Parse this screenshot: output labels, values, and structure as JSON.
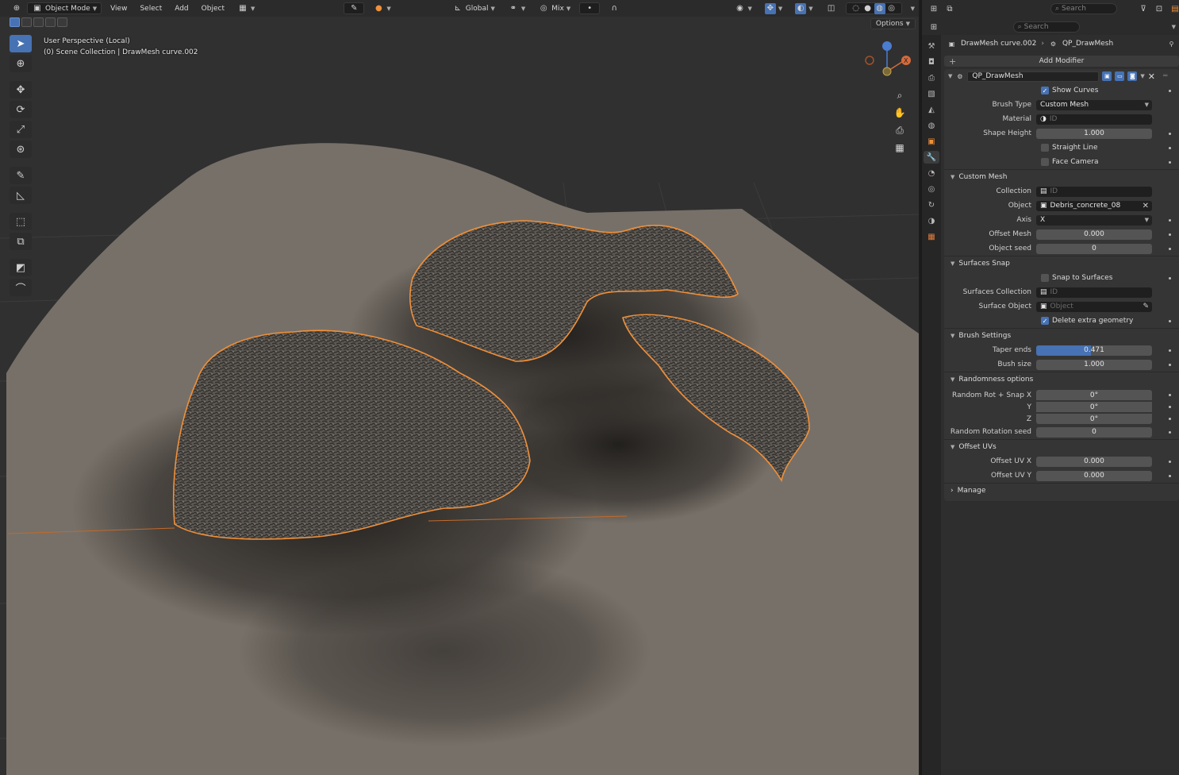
{
  "viewport": {
    "header": {
      "mode": "Object Mode",
      "menus": [
        "View",
        "Select",
        "Add",
        "Object"
      ],
      "orientation": "Global",
      "proportional": "Mix"
    },
    "options_label": "Options",
    "overlay_line1": "User Perspective (Local)",
    "overlay_line2": "(0) Scene Collection | DrawMesh curve.002",
    "gizmo_axis_x": "X"
  },
  "properties": {
    "search_placeholder": "Search",
    "search2_placeholder": "Search",
    "breadcrumb_object": "DrawMesh curve.002",
    "breadcrumb_modifier": "QP_DrawMesh",
    "add_modifier": "Add Modifier",
    "modifier_name": "QP_DrawMesh",
    "show_curves": "Show Curves",
    "brush_type_label": "Brush Type",
    "brush_type_value": "Custom Mesh",
    "material_label": "Material",
    "material_placeholder": "ID",
    "shape_height_label": "Shape Height",
    "shape_height_value": "1.000",
    "straight_line": "Straight Line",
    "face_camera": "Face Camera",
    "custom_mesh": {
      "title": "Custom Mesh",
      "collection_label": "Collection",
      "collection_placeholder": "ID",
      "object_label": "Object",
      "object_value": "Debris_concrete_08",
      "axis_label": "Axis",
      "axis_value": "X",
      "offset_mesh_label": "Offset Mesh",
      "offset_mesh_value": "0.000",
      "object_seed_label": "Object seed",
      "object_seed_value": "0"
    },
    "surfaces_snap": {
      "title": "Surfaces Snap",
      "snap_label": "Snap to Surfaces",
      "surfaces_collection_label": "Surfaces Collection",
      "surfaces_collection_placeholder": "ID",
      "surface_object_label": "Surface Object",
      "surface_object_placeholder": "Object",
      "delete_extra": "Delete extra geometry"
    },
    "brush_settings": {
      "title": "Brush Settings",
      "taper_label": "Taper ends",
      "taper_value": "0.471",
      "taper_fraction": 0.471,
      "bush_size_label": "Bush size",
      "bush_size_value": "1.000"
    },
    "randomness": {
      "title": "Randomness options",
      "rot_x_label": "Random Rot + Snap X",
      "rot_x_value": "0°",
      "rot_y_label": "Y",
      "rot_y_value": "0°",
      "rot_z_label": "Z",
      "rot_z_value": "0°",
      "seed_label": "Random Rotation seed",
      "seed_value": "0"
    },
    "offset_uvs": {
      "title": "Offset UVs",
      "uv_x_label": "Offset UV X",
      "uv_x_value": "0.000",
      "uv_y_label": "Offset UV Y",
      "uv_y_value": "0.000"
    },
    "manage": "Manage"
  },
  "colors": {
    "accent": "#4772b3",
    "selection_outline": "#f0903a",
    "viewport_bg": "#303030",
    "panel_bg": "#2e2e2e"
  }
}
